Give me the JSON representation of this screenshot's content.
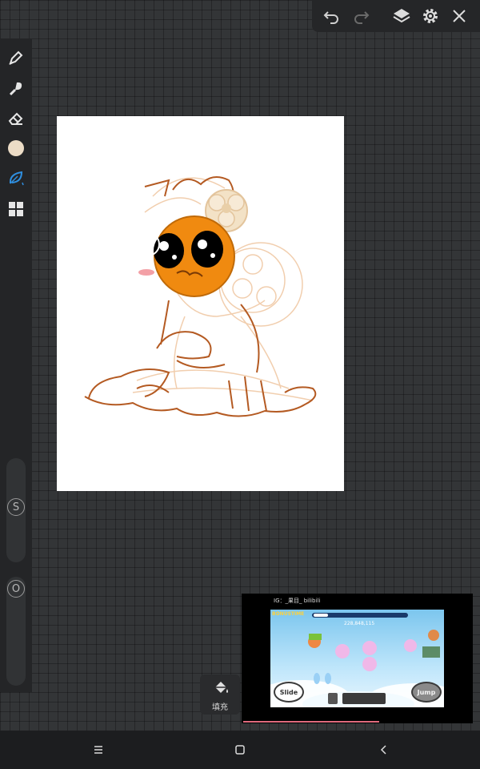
{
  "toolbar": {
    "icons": [
      "undo-icon",
      "redo-icon",
      "layers-icon",
      "settings-icon",
      "close-icon"
    ]
  },
  "sidebar": {
    "tools": [
      "pen-icon",
      "brush-icon",
      "eraser-icon",
      "color-swatch",
      "smudge-leaf-icon",
      "grid-icon"
    ],
    "current_color": "#ecdcc6",
    "active_tool_color": "#2f8fe0",
    "size_slider_label": "S",
    "opacity_slider_label": "O"
  },
  "fill_button": {
    "label": "填充"
  },
  "video_overlay": {
    "title": "IG：_果目_ bilibili",
    "game": {
      "slide_label": "Slide",
      "jump_label": "Jump",
      "score": "228,848,115",
      "bonus_label": "BONUSTIME"
    }
  },
  "navbar": {
    "icons": [
      "menu-icon",
      "home-icon",
      "back-icon"
    ]
  }
}
